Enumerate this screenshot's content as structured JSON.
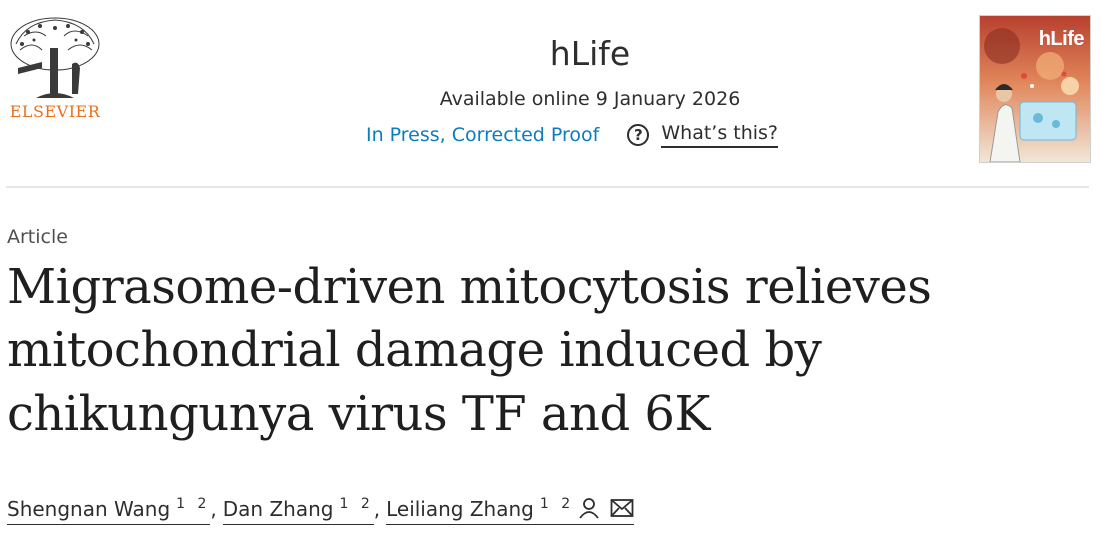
{
  "publisher": {
    "name": "ELSEVIER",
    "logo": "elsevier-tree-logo",
    "brand_color": "#e9711c"
  },
  "journal": {
    "title": "hLife",
    "cover_title": "hLife"
  },
  "availability": "Available online 9 January 2026",
  "status": {
    "label": "In Press, Corrected Proof",
    "link_color": "#0c7dbb"
  },
  "help": {
    "icon": "question-circle-icon",
    "label": "What’s this?"
  },
  "article": {
    "type": "Article",
    "title": "Migrasome-driven mitocytosis relieves mitochondrial damage induced by chikungunya virus TF and 6K"
  },
  "authors": [
    {
      "name": "Shengnan Wang",
      "affiliations": "1 2"
    },
    {
      "name": "Dan Zhang",
      "affiliations": "1 2"
    },
    {
      "name": "Leiliang Zhang",
      "affiliations": "1 2"
    }
  ],
  "separator": ",",
  "author_icons": [
    "person-icon",
    "envelope-icon"
  ]
}
